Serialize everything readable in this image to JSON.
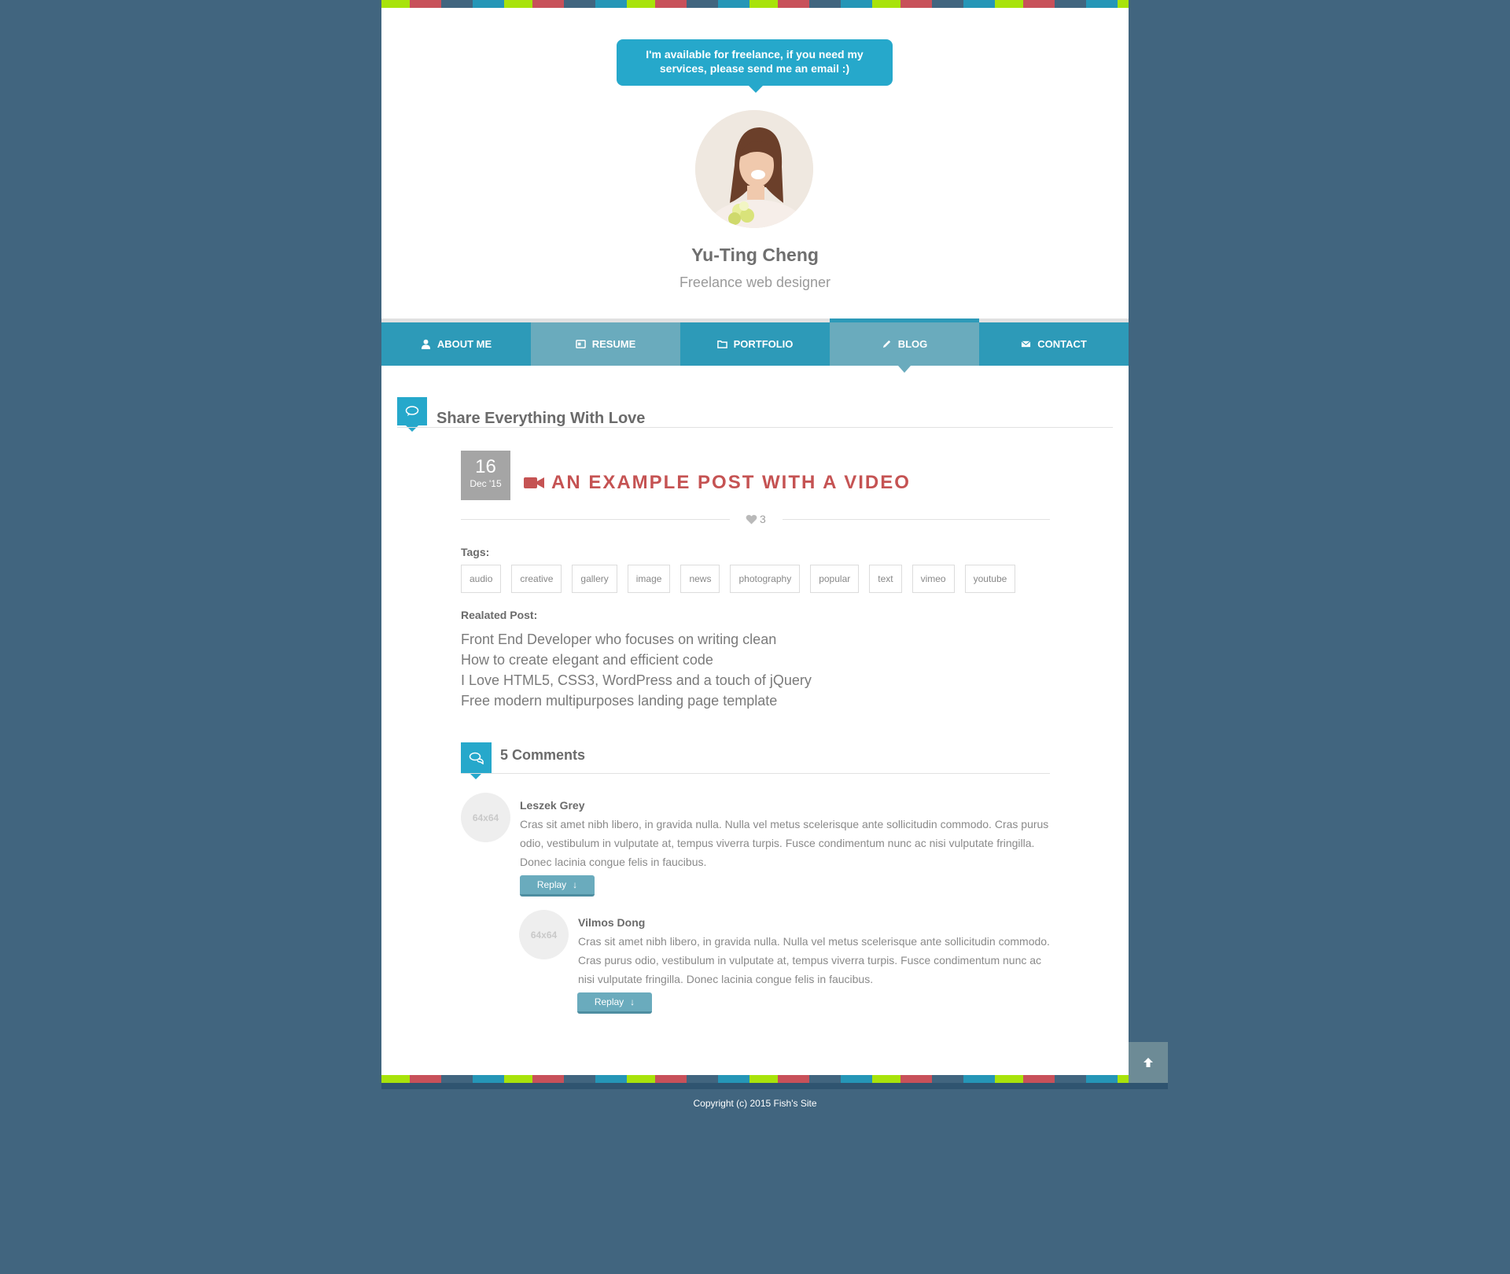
{
  "stripe_colors": [
    "#a8e30b",
    "#c8515a",
    "#41657f",
    "#2596b7"
  ],
  "header": {
    "bubble_text": "I'm available for freelance, if you need my services, please send me an email :)",
    "name": "Yu-Ting Cheng",
    "role": "Freelance web designer"
  },
  "nav": {
    "items": [
      {
        "label": "About me",
        "icon": "user-icon"
      },
      {
        "label": "Resume",
        "icon": "resume-icon"
      },
      {
        "label": "Portfolio",
        "icon": "folder-icon"
      },
      {
        "label": "Blog",
        "icon": "pencil-icon"
      },
      {
        "label": "Contact",
        "icon": "envelope-icon"
      }
    ],
    "active": "Blog"
  },
  "section": {
    "title": "Share Everything With Love"
  },
  "post": {
    "date_day": "16",
    "date_month": "Dec '15",
    "title": "AN EXAMPLE POST WITH A VIDEO",
    "likes": "3",
    "tags_label": "Tags:",
    "tags": [
      "audio",
      "creative",
      "gallery",
      "image",
      "news",
      "photography",
      "popular",
      "text",
      "vimeo",
      "youtube"
    ],
    "related_label": "Realated Post:",
    "related": [
      "Front End Developer who focuses on writing clean",
      "How to create elegant and efficient code",
      "I Love HTML5, CSS3, WordPress and a touch of jQuery",
      "Free modern multipurposes landing page template"
    ]
  },
  "comments": {
    "title": "5 Comments",
    "items": [
      {
        "avatar": "64x64",
        "author": "Leszek Grey",
        "text": "Cras sit amet nibh libero, in gravida nulla. Nulla vel metus scelerisque ante sollicitudin commodo. Cras purus odio, vestibulum in vulputate at, tempus viverra turpis. Fusce condimentum nunc ac nisi vulputate fringilla. Donec lacinia congue felis in faucibus.",
        "reply": "Replay"
      },
      {
        "avatar": "64x64",
        "author": "Vilmos Dong",
        "text": "Cras sit amet nibh libero, in gravida nulla. Nulla vel metus scelerisque ante sollicitudin commodo. Cras purus odio, vestibulum in vulputate at, tempus viverra turpis. Fusce condimentum nunc ac nisi vulputate fringilla. Donec lacinia congue felis in faucibus.",
        "reply": "Replay"
      }
    ]
  },
  "footer": {
    "copyright": "Copyright (c) 2015 Fish's Site"
  }
}
